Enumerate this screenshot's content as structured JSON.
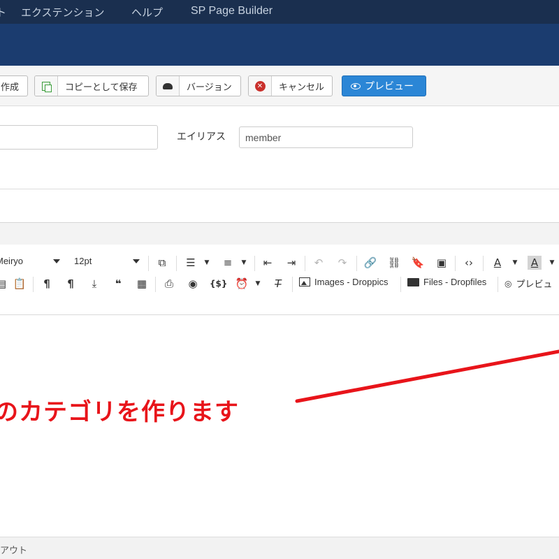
{
  "menubar": {
    "lead_fragment": "ト",
    "items": [
      "エクステンション",
      "ヘルプ",
      "SP Page Builder"
    ]
  },
  "toolbar": {
    "new_fragment": "作成",
    "save_copy_label": "コピーとして保存",
    "versions_label": "バージョン",
    "cancel_label": "キャンセル",
    "preview_label": "プレビュー",
    "preview_color": "#2b86d6"
  },
  "form": {
    "alias_label": "エイリアス",
    "alias_value": "member"
  },
  "editor_toolbar": {
    "font_family": "Meiryo",
    "font_size": "12pt",
    "images_plugin": "Images - Droppics",
    "files_plugin": "Files - Dropfiles",
    "preview_fragment": "プレビュ"
  },
  "annotation": {
    "text_fragment": "のカテゴリを作ります",
    "color": "#e8141a"
  },
  "statusbar": {
    "fragment": "アウト"
  }
}
